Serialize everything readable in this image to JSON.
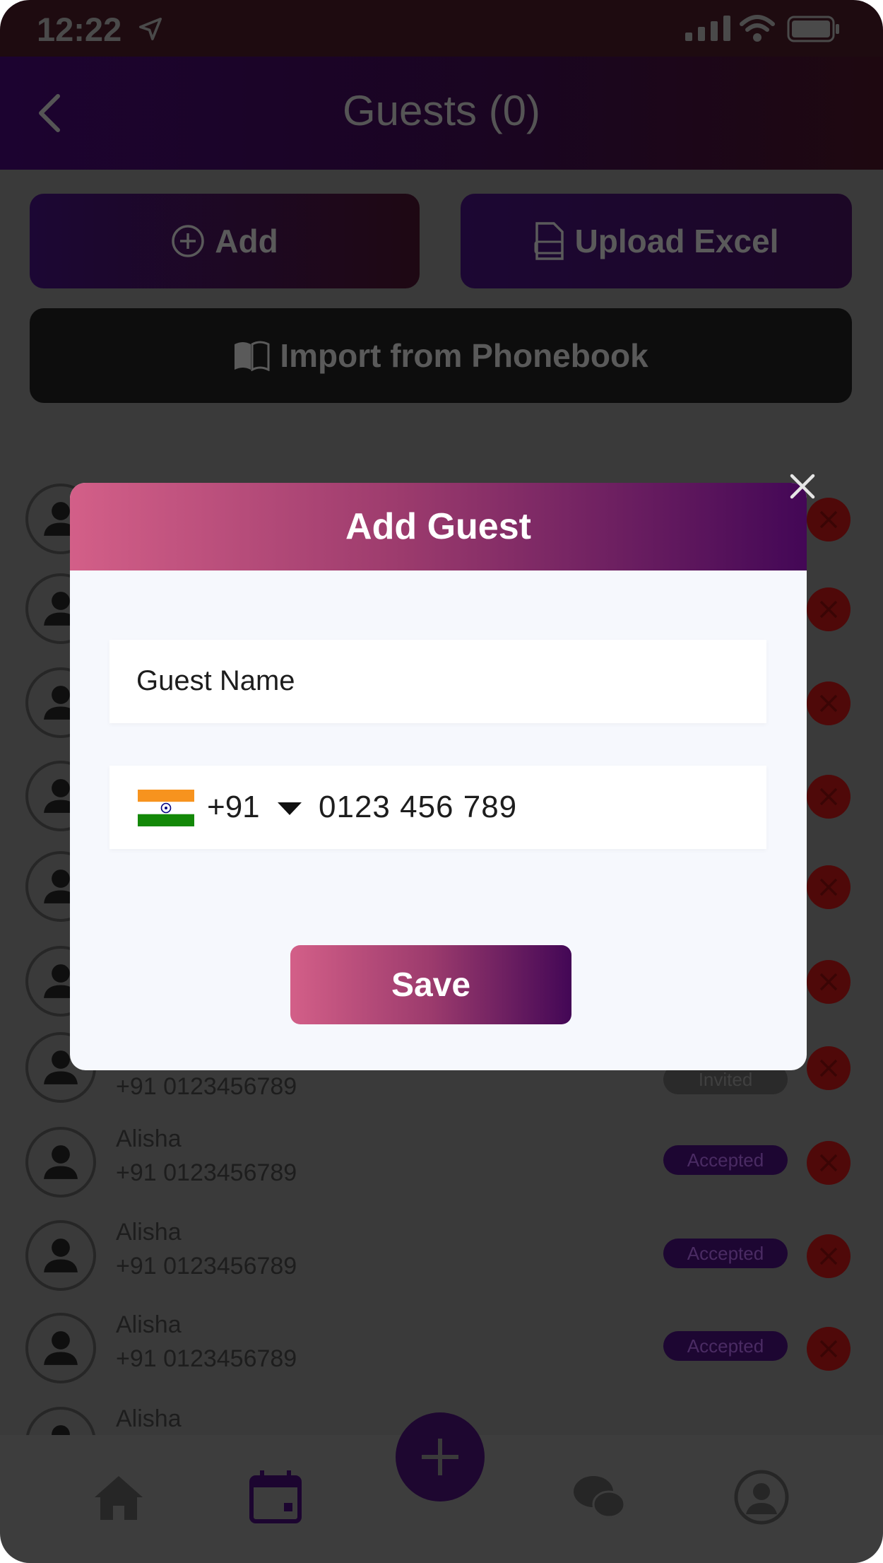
{
  "status_bar": {
    "time": "12:22"
  },
  "header": {
    "title": "Guests (0)"
  },
  "actions": {
    "add_label": "Add",
    "upload_label": "Upload Excel",
    "import_label": "Import from Phonebook"
  },
  "guests": [
    {
      "name": "",
      "phone": "",
      "status": ""
    },
    {
      "name": "",
      "phone": "",
      "status": ""
    },
    {
      "name": "",
      "phone": "",
      "status": ""
    },
    {
      "name": "",
      "phone": "",
      "status": ""
    },
    {
      "name": "",
      "phone": "",
      "status": ""
    },
    {
      "name": "",
      "phone": "",
      "status": ""
    },
    {
      "name": "",
      "phone": "+91 0123456789",
      "status": "Invited"
    },
    {
      "name": "Alisha",
      "phone": "+91 0123456789",
      "status": "Accepted"
    },
    {
      "name": "Alisha",
      "phone": "+91 0123456789",
      "status": "Accepted"
    },
    {
      "name": "Alisha",
      "phone": "+91 0123456789",
      "status": "Accepted"
    },
    {
      "name": "Alisha",
      "phone": "",
      "status": ""
    }
  ],
  "modal": {
    "title": "Add Guest",
    "name_placeholder": "Guest Name",
    "country_code": "+91",
    "phone_value": "0123 456 789",
    "save_label": "Save"
  },
  "nav": {
    "items": [
      "home-icon",
      "calendar-icon",
      "add-icon",
      "chat-icon",
      "profile-icon"
    ]
  },
  "colors": {
    "accent_start": "#d35f88",
    "accent_end": "#430756",
    "overlay": "#3a3a3a",
    "danger": "#4f0909"
  }
}
